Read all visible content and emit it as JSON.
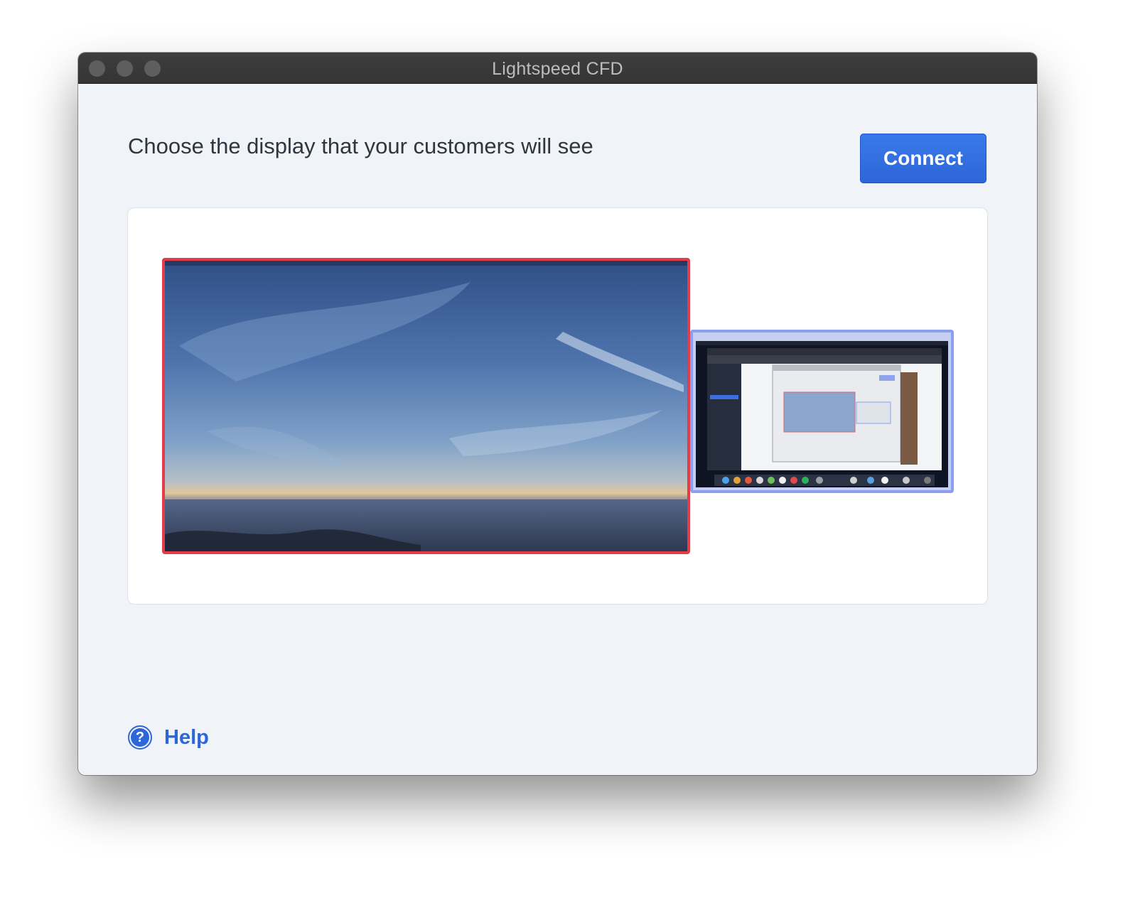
{
  "window": {
    "title": "Lightspeed CFD"
  },
  "main": {
    "heading": "Choose the display that your customers will see",
    "connect_label": "Connect"
  },
  "displays": [
    {
      "name": "primary-display",
      "selected": true,
      "border_color": "#e23b4a"
    },
    {
      "name": "secondary-display",
      "selected": false,
      "border_color": "#8aa0ef"
    }
  ],
  "footer": {
    "help_label": "Help",
    "help_glyph": "?",
    "help_icon": "question-circle-icon"
  },
  "colors": {
    "accent": "#2d66d8",
    "selected_border": "#e23b4a",
    "unselected_border": "#8aa0ef",
    "titlebar": "#383838",
    "window_bg": "#f0f3f7"
  }
}
